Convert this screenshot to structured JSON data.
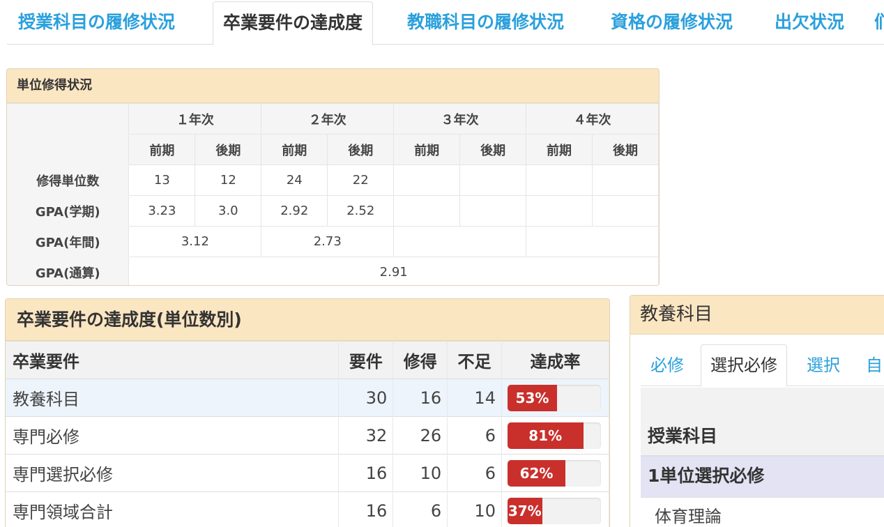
{
  "tabs": [
    {
      "label": "授業科目の履修状況",
      "active": false
    },
    {
      "label": "卒業要件の達成度",
      "active": true
    },
    {
      "label": "教職科目の履修状況",
      "active": false
    },
    {
      "label": "資格の履修状況",
      "active": false
    },
    {
      "label": "出欠状況",
      "active": false
    },
    {
      "label": "们",
      "active": false
    }
  ],
  "credits": {
    "title": "単位修得状況",
    "years": [
      "１年次",
      "２年次",
      "３年次",
      "４年次"
    ],
    "terms": [
      "前期",
      "後期",
      "前期",
      "後期",
      "前期",
      "後期",
      "前期",
      "後期"
    ],
    "rows": {
      "credits_label": "修得単位数",
      "credits": [
        "13",
        "12",
        "24",
        "22"
      ],
      "gpa_term_label": "GPA(学期)",
      "gpa_term": [
        "3.23",
        "3.0",
        "2.92",
        "2.52"
      ],
      "gpa_year_label": "GPA(年間)",
      "gpa_year": [
        "3.12",
        "2.73"
      ],
      "gpa_total_label": "GPA(通算)",
      "gpa_total": "2.91"
    }
  },
  "requirements": {
    "title": "卒業要件の達成度(単位数別)",
    "headers": {
      "name": "卒業要件",
      "required": "要件",
      "earned": "修得",
      "shortage": "不足",
      "rate": "達成率"
    },
    "rows": [
      {
        "name": "教養科目",
        "required": "30",
        "earned": "16",
        "shortage": "14",
        "rate": 53,
        "rate_label": "53%"
      },
      {
        "name": "専門必修",
        "required": "32",
        "earned": "26",
        "shortage": "6",
        "rate": 81,
        "rate_label": "81%"
      },
      {
        "name": "専門選択必修",
        "required": "16",
        "earned": "10",
        "shortage": "6",
        "rate": 62,
        "rate_label": "62%"
      },
      {
        "name": "専門領域合計",
        "required": "16",
        "earned": "6",
        "shortage": "10",
        "rate": 37,
        "rate_label": "37%"
      }
    ]
  },
  "liberal": {
    "title": "教養科目",
    "tabs": [
      {
        "label": "必修",
        "active": false
      },
      {
        "label": "選択必修",
        "active": true
      },
      {
        "label": "選択",
        "active": false
      },
      {
        "label": "自",
        "active": false
      }
    ],
    "column": "授業科目",
    "group": "1単位選択必修",
    "items": [
      "体育理論"
    ]
  },
  "colors": {
    "tab_link": "#2aa0dc",
    "panel_header": "#fbe6c2",
    "progress": "#c9302c",
    "row_highlight": "#edf4fb",
    "group_row": "#e4e3f3"
  }
}
